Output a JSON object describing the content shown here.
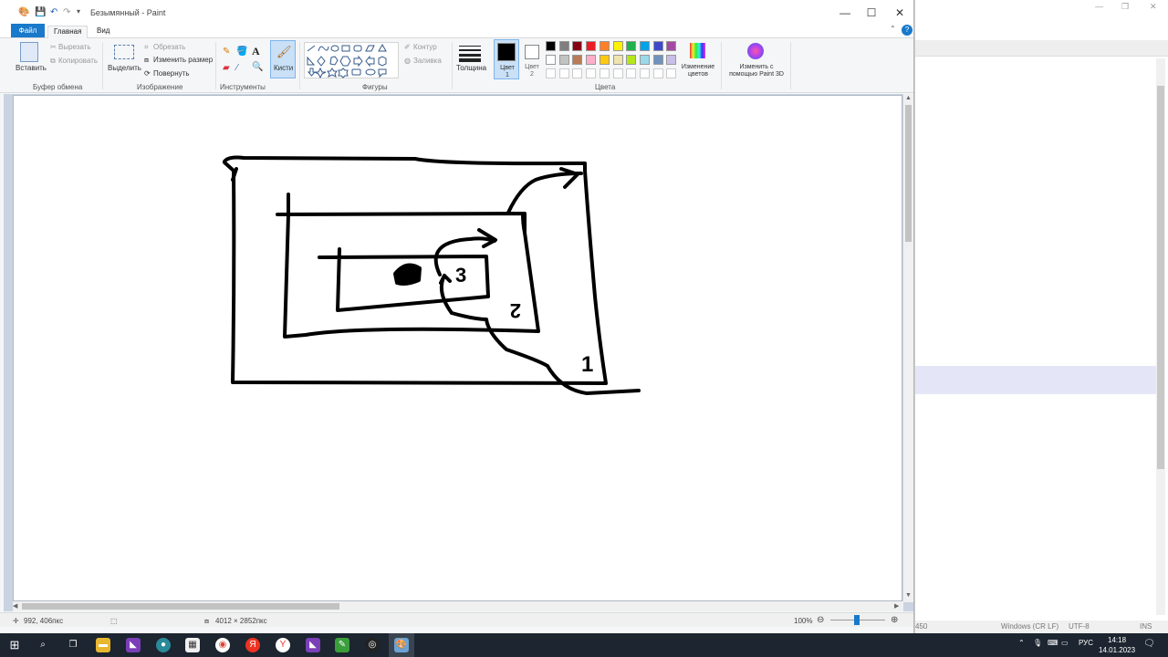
{
  "window": {
    "title": "Безымянный - Paint"
  },
  "menu": {
    "file": "Файл",
    "home": "Главная",
    "view": "Вид"
  },
  "ribbon": {
    "clipboard": {
      "paste": "Вставить",
      "cut": "Вырезать",
      "copy": "Копировать",
      "group": "Буфер обмена"
    },
    "image": {
      "select": "Выделить",
      "crop": "Обрезать",
      "resize": "Изменить размер",
      "rotate": "Повернуть",
      "group": "Изображение"
    },
    "tools": {
      "group": "Инструменты"
    },
    "brushes": {
      "label": "Кисти"
    },
    "shapes": {
      "outline": "Контур",
      "fill": "Заливка",
      "group": "Фигуры"
    },
    "size": {
      "label": "Толщина"
    },
    "colors": {
      "color1": "Цвет 1",
      "color2": "Цвет 2",
      "edit": "Изменение цветов",
      "paint3d": "Изменить с помощью Paint 3D",
      "group": "Цвета",
      "palette": [
        "#000000",
        "#7f7f7f",
        "#880015",
        "#ed1c24",
        "#ff7f27",
        "#fff200",
        "#22b14c",
        "#00a2e8",
        "#3f48cc",
        "#a349a4",
        "#ffffff",
        "#c3c3c3",
        "#b97a57",
        "#ffaec9",
        "#ffc90e",
        "#efe4b0",
        "#b5e61d",
        "#99d9ea",
        "#7092be",
        "#c8bfe7"
      ]
    }
  },
  "drawing": {
    "labels": [
      "3",
      "2",
      "1"
    ]
  },
  "status": {
    "cursor": "992, 406пкс",
    "image_size": "4012 × 2852пкс",
    "zoom": "100%"
  },
  "bg_app": {
    "encoding_eol": "Windows (CR LF)",
    "encoding": "UTF-8",
    "mode": "INS",
    "col": "450"
  },
  "taskbar": {
    "lang": "РУС",
    "time": "14:18",
    "date": "14.01.2023"
  }
}
